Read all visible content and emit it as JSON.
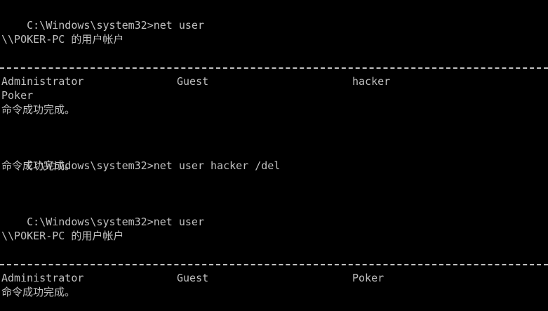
{
  "console": {
    "prompt": "C:\\Windows\\system32>",
    "blocks": {
      "cmd1": "net user",
      "header1": "\\\\POKER-PC 的用户帐户",
      "users1": [
        "Administrator",
        "Guest",
        "hacker",
        "Poker"
      ],
      "done1": "命令成功完成。",
      "cmd2": "net user hacker /del",
      "done2": "命令成功完成。",
      "cmd3": "net user",
      "header2": "\\\\POKER-PC 的用户帐户",
      "users2": [
        "Administrator",
        "Guest",
        "Poker"
      ],
      "done3": "命令成功完成。"
    }
  },
  "colors": {
    "background": "#000000",
    "text": "#c0c0c0"
  }
}
